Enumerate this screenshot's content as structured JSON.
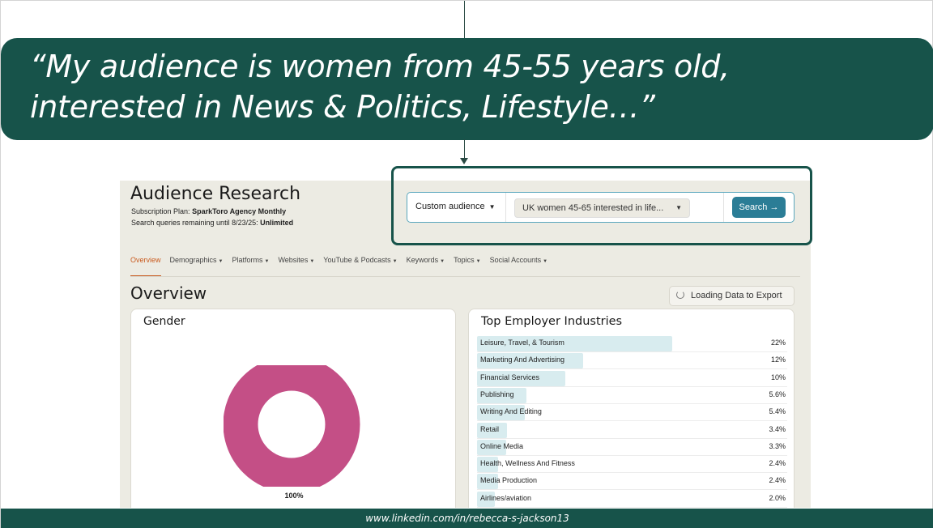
{
  "quote": {
    "text": "“My audience is women from 45-55 years old,\ninterested in News & Politics, Lifestyle…”"
  },
  "app": {
    "title": "Audience Research",
    "plan_label": "Subscription Plan:",
    "plan_value": "SparkToro Agency Monthly",
    "queries_label": "Search queries remaining until 8/23/25:",
    "queries_value": "Unlimited"
  },
  "search": {
    "audience_type": "Custom audience",
    "query": "UK women 45-65 interested in life...",
    "button_label": "Search →"
  },
  "tabs": [
    {
      "label": "Overview",
      "active": true
    },
    {
      "label": "Demographics"
    },
    {
      "label": "Platforms"
    },
    {
      "label": "Websites"
    },
    {
      "label": "YouTube & Podcasts"
    },
    {
      "label": "Keywords"
    },
    {
      "label": "Topics"
    },
    {
      "label": "Social Accounts"
    }
  ],
  "overview": {
    "title": "Overview",
    "export_label": "Loading Data to Export"
  },
  "gender": {
    "title": "Gender",
    "value_label": "100%",
    "color": "#c44f86"
  },
  "industries": {
    "title": "Top Employer Industries",
    "bar_color": "#d8ecef"
  },
  "chart_data": {
    "type": "bar",
    "title": "Top Employer Industries",
    "categories": [
      "Leisure, Travel, & Tourism",
      "Marketing And Advertising",
      "Financial Services",
      "Publishing",
      "Writing And Editing",
      "Retail",
      "Online Media",
      "Health, Wellness And Fitness",
      "Media Production",
      "Airlines/aviation"
    ],
    "values": [
      22,
      12,
      10,
      5.6,
      5.4,
      3.4,
      3.3,
      2.4,
      2.4,
      2.0
    ],
    "labels": [
      "22%",
      "12%",
      "10%",
      "5.6%",
      "5.4%",
      "3.4%",
      "3.3%",
      "2.4%",
      "2.4%",
      "2.0%"
    ],
    "orientation": "horizontal",
    "xlim": [
      0,
      35
    ]
  },
  "footer": {
    "text": "www.linkedin.com/in/rebecca-s-jackson13"
  }
}
